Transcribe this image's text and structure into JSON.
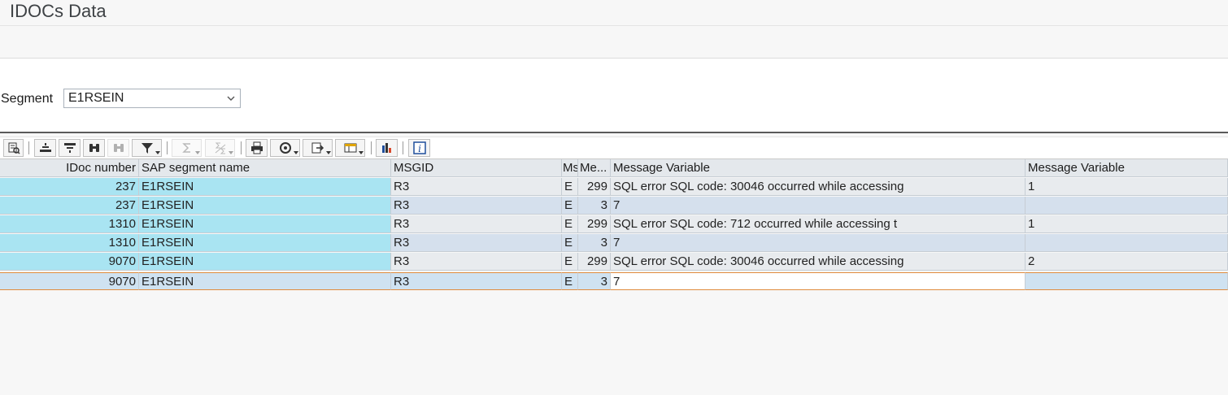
{
  "window": {
    "title": "IDOCs Data"
  },
  "segment": {
    "label": "Segment",
    "value": "E1RSEIN"
  },
  "toolbar": {
    "buttons": [
      "details-icon",
      "sort-ascending-icon",
      "sort-descending-icon",
      "find-icon",
      "find-next-icon",
      "filter-icon",
      "total-icon",
      "subtotal-icon",
      "print-icon",
      "view-icon",
      "export-icon",
      "layout-icon",
      "graphic-icon",
      "info-icon"
    ]
  },
  "table": {
    "columns": [
      "IDoc number",
      "SAP segment name",
      "MSGID",
      "Ms",
      "Me...",
      "Message Variable",
      "Message Variable"
    ],
    "rows": [
      [
        "237",
        "E1RSEIN",
        "R3",
        "E",
        "299",
        "SQL error SQL code: 30046 occurred while accessing",
        "1"
      ],
      [
        "237",
        "E1RSEIN",
        "R3",
        "E",
        "3",
        "7",
        ""
      ],
      [
        "1310",
        "E1RSEIN",
        "R3",
        "E",
        "299",
        "SQL error SQL code: 712 occurred while accessing t",
        "1"
      ],
      [
        "1310",
        "E1RSEIN",
        "R3",
        "E",
        "3",
        "7",
        ""
      ],
      [
        "9070",
        "E1RSEIN",
        "R3",
        "E",
        "299",
        "SQL error SQL code: 30046 occurred while accessing",
        "2"
      ],
      [
        "9070",
        "E1RSEIN",
        "R3",
        "E",
        "3",
        "7",
        ""
      ]
    ]
  },
  "colors": {
    "key_column": "#a9e4f2",
    "selected_row_border": "#e08b3d"
  }
}
